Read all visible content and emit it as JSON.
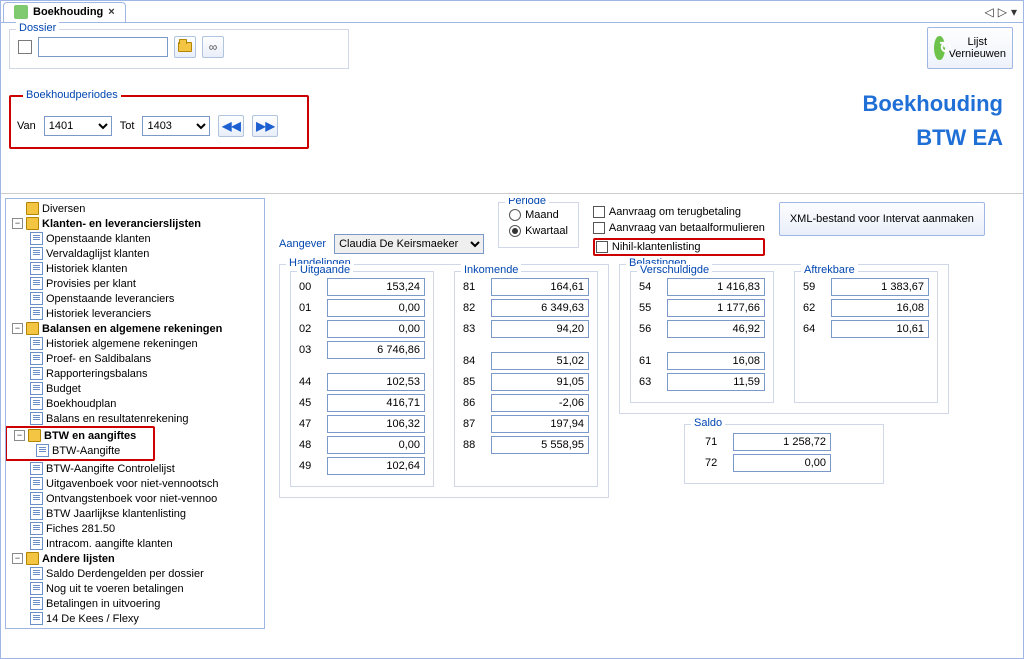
{
  "tab": {
    "title": "Boekhouding",
    "close": "×"
  },
  "tabbar_nav": {
    "prev": "◁",
    "next": "▷",
    "menu": "▾"
  },
  "dossier": {
    "legend": "Dossier",
    "value": ""
  },
  "periodes": {
    "legend": "Boekhoudperiodes",
    "van_label": "Van",
    "van_value": "1401",
    "tot_label": "Tot",
    "tot_value": "1403",
    "prev": "◀◀",
    "next": "▶▶"
  },
  "refresh": {
    "line1": "Lijst",
    "line2": "Vernieuwen"
  },
  "headline": {
    "h1": "Boekhouding",
    "h2": "BTW EA"
  },
  "tree": {
    "diversen": "Diversen",
    "klantlev": "Klanten- en leverancierslijsten",
    "klantlev_children": [
      "Openstaande klanten",
      "Vervaldaglijst klanten",
      "Historiek klanten",
      "Provisies per klant",
      "Openstaande leveranciers",
      "Historiek leveranciers"
    ],
    "balansen": "Balansen en algemene rekeningen",
    "balansen_children": [
      "Historiek algemene rekeningen",
      "Proef- en Saldibalans",
      "Rapporteringsbalans",
      "Budget",
      "Boekhoudplan",
      "Balans en resultatenrekening"
    ],
    "btw": "BTW en aangiftes",
    "btw_children": [
      "BTW-Aangifte",
      "BTW-Aangifte Controlelijst",
      "Uitgavenboek voor niet-vennootsch",
      "Ontvangstenboek voor niet-vennoo",
      "BTW Jaarlijkse klantenlisting",
      "Fiches 281.50",
      "Intracom. aangifte klanten"
    ],
    "andere": "Andere lijsten",
    "andere_children": [
      "Saldo Derdengelden per dossier",
      "Nog uit te voeren betalingen",
      "Betalingen in uitvoering",
      "14       De Kees / Flexy"
    ]
  },
  "detail": {
    "aangever_label": "Aangever",
    "aangever_value": "Claudia De Keirsmaeker",
    "periode_legend": "Periode",
    "maand_label": "Maand",
    "kwartaal_label": "Kwartaal",
    "chk_terug": "Aanvraag om terugbetaling",
    "chk_betaal": "Aanvraag van betaalformulieren",
    "chk_nihil": "Nihil-klantenlisting",
    "xml_btn": "XML-bestand voor Intervat aanmaken",
    "handelingen_legend": "Handelingen",
    "uitgaande_legend": "Uitgaande",
    "inkomende_legend": "Inkomende",
    "belastingen_legend": "Belastingen",
    "verschuldigde_legend": "Verschuldigde",
    "aftrekbare_legend": "Aftrekbare",
    "saldo_legend": "Saldo",
    "uitgaande": [
      {
        "c": "00",
        "v": "153,24"
      },
      {
        "c": "01",
        "v": "0,00"
      },
      {
        "c": "02",
        "v": "0,00"
      },
      {
        "c": "03",
        "v": "6 746,86"
      },
      {
        "c": "44",
        "v": "102,53"
      },
      {
        "c": "45",
        "v": "416,71"
      },
      {
        "c": "47",
        "v": "106,32"
      },
      {
        "c": "48",
        "v": "0,00"
      },
      {
        "c": "49",
        "v": "102,64"
      }
    ],
    "inkomende": [
      {
        "c": "81",
        "v": "164,61"
      },
      {
        "c": "82",
        "v": "6 349,63"
      },
      {
        "c": "83",
        "v": "94,20"
      },
      {
        "c": "84",
        "v": "51,02"
      },
      {
        "c": "85",
        "v": "91,05"
      },
      {
        "c": "86",
        "v": "-2,06"
      },
      {
        "c": "87",
        "v": "197,94"
      },
      {
        "c": "88",
        "v": "5 558,95"
      }
    ],
    "verschuldigde": [
      {
        "c": "54",
        "v": "1 416,83"
      },
      {
        "c": "55",
        "v": "1 177,66"
      },
      {
        "c": "56",
        "v": "46,92"
      },
      {
        "c": "61",
        "v": "16,08"
      },
      {
        "c": "63",
        "v": "11,59"
      }
    ],
    "aftrekbare": [
      {
        "c": "59",
        "v": "1 383,67"
      },
      {
        "c": "62",
        "v": "16,08"
      },
      {
        "c": "64",
        "v": "10,61"
      }
    ],
    "saldo": [
      {
        "c": "71",
        "v": "1 258,72"
      },
      {
        "c": "72",
        "v": "0,00"
      }
    ]
  }
}
